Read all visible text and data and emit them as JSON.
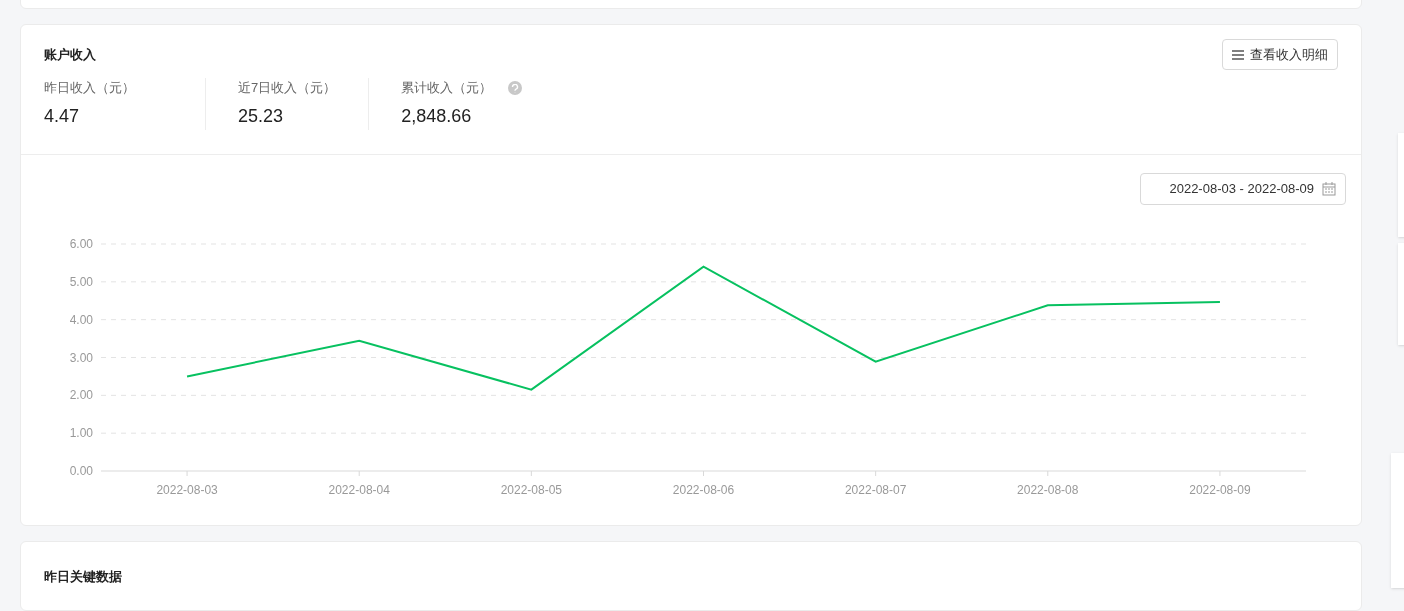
{
  "income_card": {
    "title": "账户收入",
    "detail_button": "查看收入明细",
    "stats": [
      {
        "label": "昨日收入（元）",
        "value": "4.47",
        "help": false
      },
      {
        "label": "近7日收入（元）",
        "value": "25.23",
        "help": false
      },
      {
        "label": "累计收入（元）",
        "value": "2,848.66",
        "help": true
      }
    ],
    "date_range": "2022-08-03 - 2022-08-09",
    "chart_data": {
      "type": "line",
      "categories": [
        "2022-08-03",
        "2022-08-04",
        "2022-08-05",
        "2022-08-06",
        "2022-08-07",
        "2022-08-08",
        "2022-08-09"
      ],
      "grid": true,
      "series": [
        {
          "color": "#07c160",
          "values": [
            2.5,
            3.44,
            2.15,
            5.4,
            2.89,
            4.38,
            4.47
          ]
        }
      ],
      "ylim": [
        0,
        6
      ],
      "yticks": [
        {
          "value": 0,
          "label": "0.00"
        },
        {
          "value": 1,
          "label": "1.00"
        },
        {
          "value": 2,
          "label": "2.00"
        },
        {
          "value": 3,
          "label": "3.00"
        },
        {
          "value": 4,
          "label": "4.00"
        },
        {
          "value": 5,
          "label": "5.00"
        },
        {
          "value": 6,
          "label": "6.00"
        }
      ]
    }
  },
  "key_data_card": {
    "title": "昨日关键数据"
  }
}
